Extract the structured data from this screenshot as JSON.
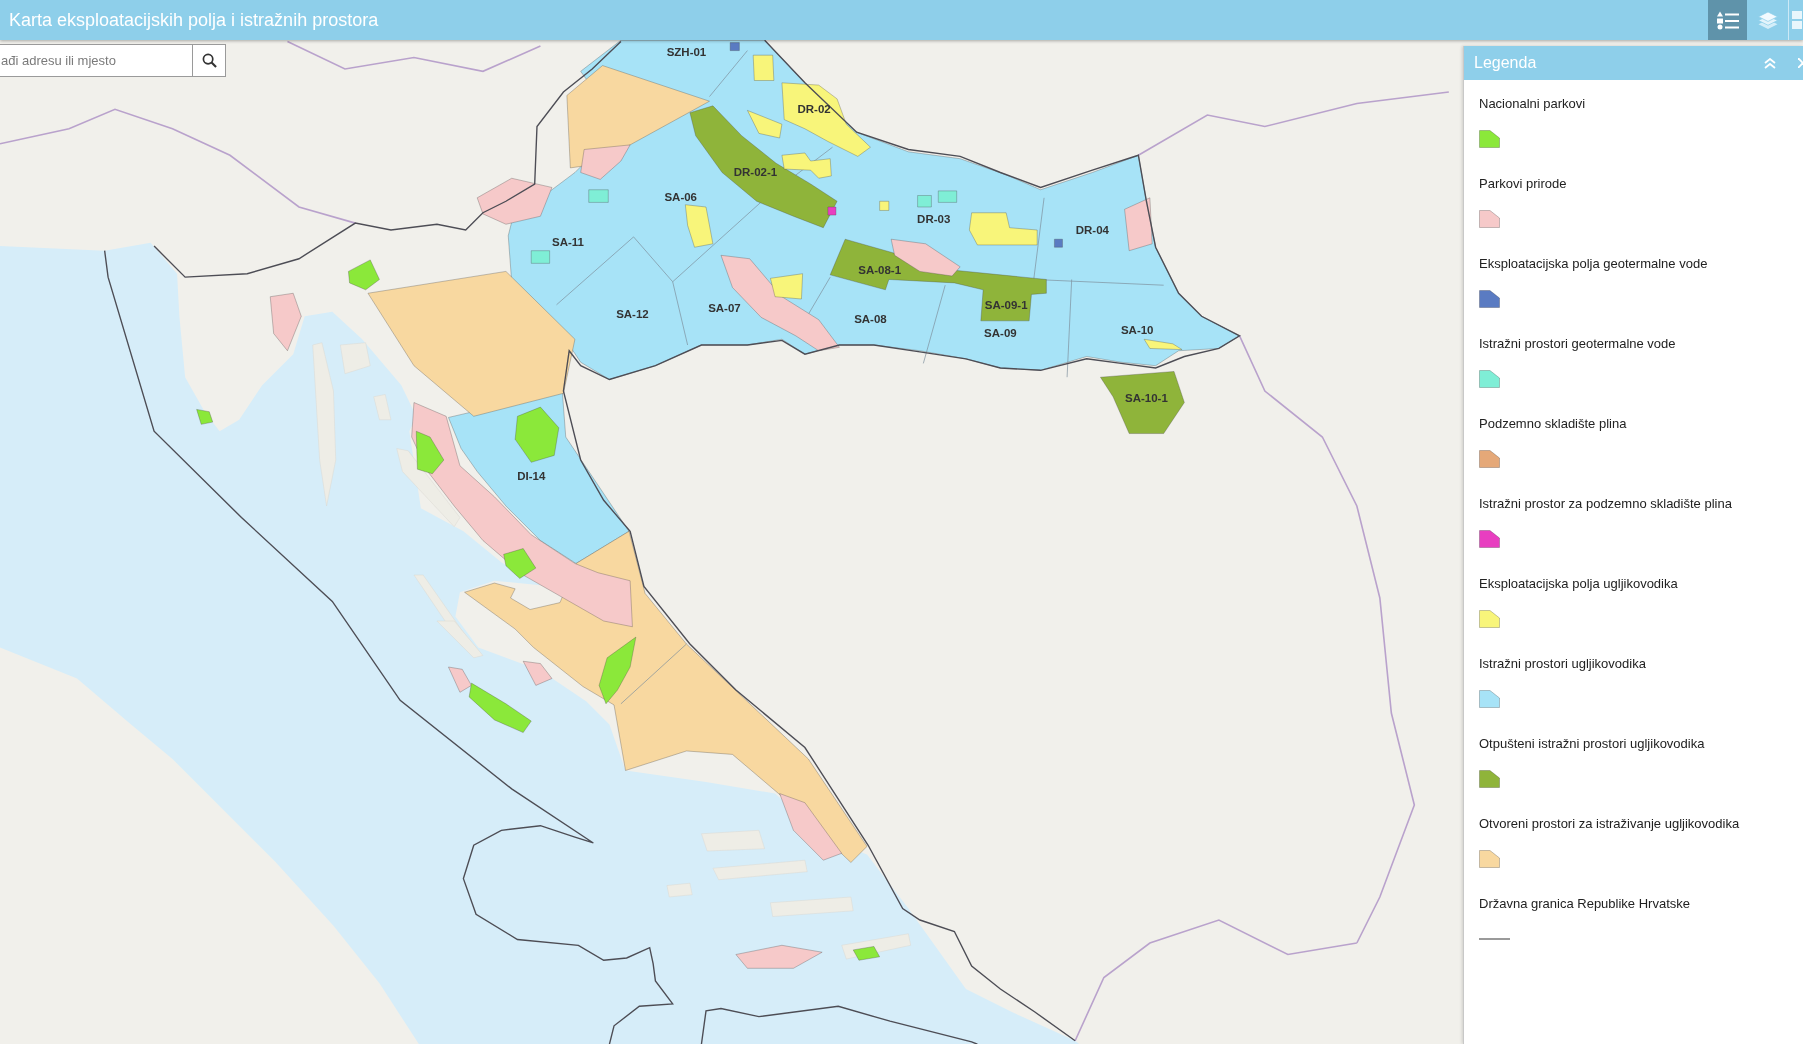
{
  "header": {
    "title": "Karta eksploatacijskih polja i istražnih prostora",
    "tools": [
      {
        "kind": "legend",
        "selected": true
      },
      {
        "kind": "layers",
        "selected": false
      },
      {
        "kind": "panel",
        "selected": false
      }
    ]
  },
  "search": {
    "placeholder": "ađi adresu ili mjesto"
  },
  "map": {
    "block_labels": [
      "SZH-01",
      "DR-02",
      "DR-02-1",
      "SA-06",
      "DR-03",
      "DR-04",
      "SA-11",
      "SA-08-1",
      "SA-09-1",
      "SA-07",
      "SA-12",
      "SA-08",
      "SA-09",
      "SA-10",
      "SA-10-1",
      "DI-14"
    ]
  },
  "legend": {
    "title": "Legenda",
    "items": [
      {
        "label": "Nacionalni parkovi",
        "kind": "polygon",
        "color": "#8be83a"
      },
      {
        "label": "Parkovi prirode",
        "kind": "polygon",
        "color": "#f6c9c9"
      },
      {
        "label": "Eksploatacijska polja geotermalne vode",
        "kind": "polygon",
        "color": "#5a7bc2"
      },
      {
        "label": "Istražni prostori geotermalne vode",
        "kind": "polygon",
        "color": "#7feed6"
      },
      {
        "label": "Podzemno skladište plina",
        "kind": "polygon",
        "color": "#e5a878"
      },
      {
        "label": "Istražni prostor za podzemno skladište plina",
        "kind": "polygon",
        "color": "#e83ec0"
      },
      {
        "label": "Eksploatacijska polja ugljikovodika",
        "kind": "polygon",
        "color": "#f8f57a"
      },
      {
        "label": "Istražni prostori ugljikovodika",
        "kind": "polygon",
        "color": "#a7e3f7"
      },
      {
        "label": "Otpušteni istražni prostori ugljikovodika",
        "kind": "polygon",
        "color": "#8fb43a"
      },
      {
        "label": "Otvoreni prostori za istraživanje ugljikovodika",
        "kind": "polygon",
        "color": "#f8d8a0"
      },
      {
        "label": "Državna granica Republike Hrvatske",
        "kind": "line",
        "color": "#9a9a9a"
      }
    ]
  }
}
